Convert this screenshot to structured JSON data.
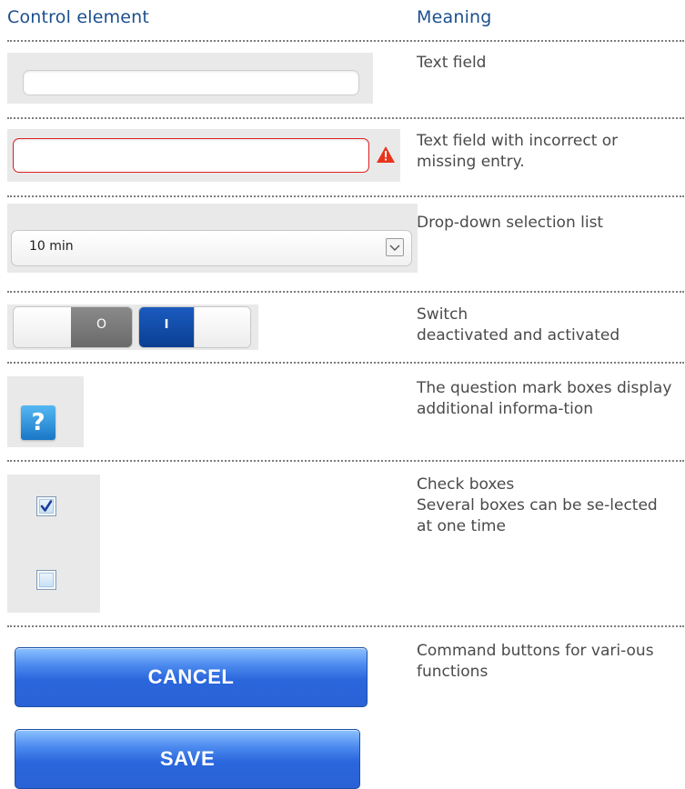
{
  "headers": {
    "control": "Control element",
    "meaning": "Meaning"
  },
  "rows": [
    {
      "meaning": "Text field"
    },
    {
      "meaning": "Text field with incorrect or missing entry."
    },
    {
      "meaning": "Drop-down selection list"
    },
    {
      "meaning": "Switch\ndeactivated and activated"
    },
    {
      "meaning": "The question mark boxes display additional informa-tion"
    },
    {
      "meaning": "Check boxes\nSeveral boxes can be se-lected at one time"
    },
    {
      "meaning": "Command buttons for vari-ous functions"
    }
  ],
  "controls": {
    "dropdown_value": "10 min",
    "switch_off_symbol": "O",
    "switch_on_symbol": "I",
    "help_symbol": "?",
    "checkbox_1_checked": true,
    "checkbox_2_checked": false,
    "cancel_label": "CANCEL",
    "save_label": "SAVE",
    "warning_icon": "warning-triangle",
    "dropdown_icon": "chevron-down"
  },
  "colors": {
    "header_blue": "#1c4f8e",
    "error_red": "#e02020",
    "button_blue": "#2a66dc",
    "switch_dark": "#7a7a7a",
    "switch_active": "#0e4fa8"
  }
}
